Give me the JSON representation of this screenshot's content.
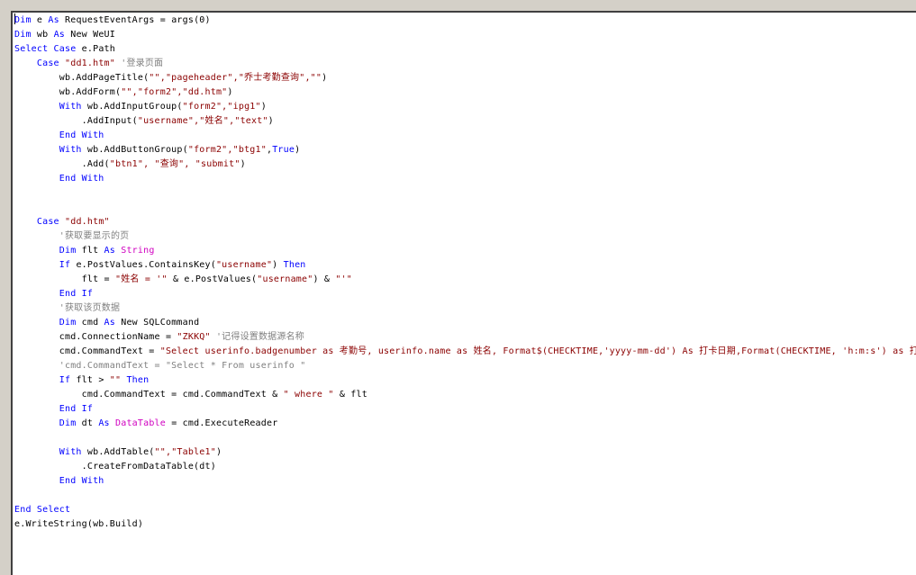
{
  "colors": {
    "keyword": "#0000ff",
    "type": "#d000c0",
    "string": "#8b0000",
    "comment": "#808080",
    "text": "#000000",
    "background": "#ffffff",
    "chrome": "#d4d0c8"
  },
  "editor": {
    "lines": [
      [
        {
          "t": "kw",
          "v": "Dim"
        },
        {
          "t": "tx",
          "v": " e "
        },
        {
          "t": "kw",
          "v": "As"
        },
        {
          "t": "tx",
          "v": " RequestEventArgs = args(0)"
        }
      ],
      [
        {
          "t": "kw",
          "v": "Dim"
        },
        {
          "t": "tx",
          "v": " wb "
        },
        {
          "t": "kw",
          "v": "As"
        },
        {
          "t": "tx",
          "v": " New WeUI"
        }
      ],
      [
        {
          "t": "kw",
          "v": "Select Case"
        },
        {
          "t": "tx",
          "v": " e.Path"
        }
      ],
      [
        {
          "t": "tx",
          "v": "    "
        },
        {
          "t": "kw",
          "v": "Case"
        },
        {
          "t": "tx",
          "v": " "
        },
        {
          "t": "str",
          "v": "\"dd1.htm\""
        },
        {
          "t": "cm",
          "v": " '登录页面"
        }
      ],
      [
        {
          "t": "tx",
          "v": "        wb.AddPageTitle("
        },
        {
          "t": "str",
          "v": "\"\",\"pageheader\",\"乔士考勤查询\",\"\""
        },
        {
          "t": "tx",
          "v": ")"
        }
      ],
      [
        {
          "t": "tx",
          "v": "        wb.AddForm("
        },
        {
          "t": "str",
          "v": "\"\",\"form2\",\"dd.htm\""
        },
        {
          "t": "tx",
          "v": ")"
        }
      ],
      [
        {
          "t": "tx",
          "v": "        "
        },
        {
          "t": "kw",
          "v": "With"
        },
        {
          "t": "tx",
          "v": " wb.AddInputGroup("
        },
        {
          "t": "str",
          "v": "\"form2\",\"ipg1\""
        },
        {
          "t": "tx",
          "v": ")"
        }
      ],
      [
        {
          "t": "tx",
          "v": "            .AddInput("
        },
        {
          "t": "str",
          "v": "\"username\",\"姓名\",\"text\""
        },
        {
          "t": "tx",
          "v": ")"
        }
      ],
      [
        {
          "t": "tx",
          "v": "        "
        },
        {
          "t": "kw",
          "v": "End With"
        }
      ],
      [
        {
          "t": "tx",
          "v": "        "
        },
        {
          "t": "kw",
          "v": "With"
        },
        {
          "t": "tx",
          "v": " wb.AddButtonGroup("
        },
        {
          "t": "str",
          "v": "\"form2\",\"btg1\""
        },
        {
          "t": "tx",
          "v": ","
        },
        {
          "t": "kw",
          "v": "True"
        },
        {
          "t": "tx",
          "v": ")"
        }
      ],
      [
        {
          "t": "tx",
          "v": "            .Add("
        },
        {
          "t": "str",
          "v": "\"btn1\", \"查询\", \"submit\""
        },
        {
          "t": "tx",
          "v": ")"
        }
      ],
      [
        {
          "t": "tx",
          "v": "        "
        },
        {
          "t": "kw",
          "v": "End With"
        }
      ],
      [],
      [],
      [
        {
          "t": "tx",
          "v": "    "
        },
        {
          "t": "kw",
          "v": "Case"
        },
        {
          "t": "tx",
          "v": " "
        },
        {
          "t": "str",
          "v": "\"dd.htm\""
        }
      ],
      [
        {
          "t": "cm",
          "v": "        '获取要显示的页"
        }
      ],
      [
        {
          "t": "tx",
          "v": "        "
        },
        {
          "t": "kw",
          "v": "Dim"
        },
        {
          "t": "tx",
          "v": " flt "
        },
        {
          "t": "kw",
          "v": "As"
        },
        {
          "t": "tx",
          "v": " "
        },
        {
          "t": "tp",
          "v": "String"
        }
      ],
      [
        {
          "t": "tx",
          "v": "        "
        },
        {
          "t": "kw",
          "v": "If"
        },
        {
          "t": "tx",
          "v": " e.PostValues.ContainsKey("
        },
        {
          "t": "str",
          "v": "\"username\""
        },
        {
          "t": "tx",
          "v": ") "
        },
        {
          "t": "kw",
          "v": "Then"
        }
      ],
      [
        {
          "t": "tx",
          "v": "            flt = "
        },
        {
          "t": "str",
          "v": "\"姓名 = '\""
        },
        {
          "t": "tx",
          "v": " & e.PostValues("
        },
        {
          "t": "str",
          "v": "\"username\""
        },
        {
          "t": "tx",
          "v": ") & "
        },
        {
          "t": "str",
          "v": "\"'\""
        }
      ],
      [
        {
          "t": "tx",
          "v": "        "
        },
        {
          "t": "kw",
          "v": "End If"
        }
      ],
      [
        {
          "t": "cm",
          "v": "        '获取该页数据"
        }
      ],
      [
        {
          "t": "tx",
          "v": "        "
        },
        {
          "t": "kw",
          "v": "Dim"
        },
        {
          "t": "tx",
          "v": " cmd "
        },
        {
          "t": "kw",
          "v": "As"
        },
        {
          "t": "tx",
          "v": " New SQLCommand"
        }
      ],
      [
        {
          "t": "tx",
          "v": "        cmd.ConnectionName = "
        },
        {
          "t": "str",
          "v": "\"ZKKQ\""
        },
        {
          "t": "cm",
          "v": " '记得设置数据源名称"
        }
      ],
      [
        {
          "t": "tx",
          "v": "        cmd.CommandText = "
        },
        {
          "t": "str",
          "v": "\"Select userinfo.badgenumber as 考勤号, userinfo.name as 姓名, Format$(CHECKTIME,'yyyy-mm-dd') As 打卡日期,Format(CHECKTIME, 'h:m:s') as 打卡"
        }
      ],
      [
        {
          "t": "cm",
          "v": "        'cmd.CommandText = \"Select * From userinfo \""
        }
      ],
      [
        {
          "t": "tx",
          "v": "        "
        },
        {
          "t": "kw",
          "v": "If"
        },
        {
          "t": "tx",
          "v": " flt > "
        },
        {
          "t": "str",
          "v": "\"\""
        },
        {
          "t": "tx",
          "v": " "
        },
        {
          "t": "kw",
          "v": "Then"
        }
      ],
      [
        {
          "t": "tx",
          "v": "            cmd.CommandText = cmd.CommandText & "
        },
        {
          "t": "str",
          "v": "\" where \""
        },
        {
          "t": "tx",
          "v": " & flt"
        }
      ],
      [
        {
          "t": "tx",
          "v": "        "
        },
        {
          "t": "kw",
          "v": "End If"
        }
      ],
      [
        {
          "t": "tx",
          "v": "        "
        },
        {
          "t": "kw",
          "v": "Dim"
        },
        {
          "t": "tx",
          "v": " dt "
        },
        {
          "t": "kw",
          "v": "As"
        },
        {
          "t": "tx",
          "v": " "
        },
        {
          "t": "tp",
          "v": "DataTable"
        },
        {
          "t": "tx",
          "v": " = cmd.ExecuteReader"
        }
      ],
      [],
      [
        {
          "t": "tx",
          "v": "        "
        },
        {
          "t": "kw",
          "v": "With"
        },
        {
          "t": "tx",
          "v": " wb.AddTable("
        },
        {
          "t": "str",
          "v": "\"\",\"Table1\""
        },
        {
          "t": "tx",
          "v": ")"
        }
      ],
      [
        {
          "t": "tx",
          "v": "            .CreateFromDataTable(dt)"
        }
      ],
      [
        {
          "t": "tx",
          "v": "        "
        },
        {
          "t": "kw",
          "v": "End With"
        }
      ],
      [],
      [
        {
          "t": "kw",
          "v": "End Select"
        }
      ],
      [
        {
          "t": "tx",
          "v": "e.WriteString(wb.Build)"
        }
      ]
    ]
  }
}
